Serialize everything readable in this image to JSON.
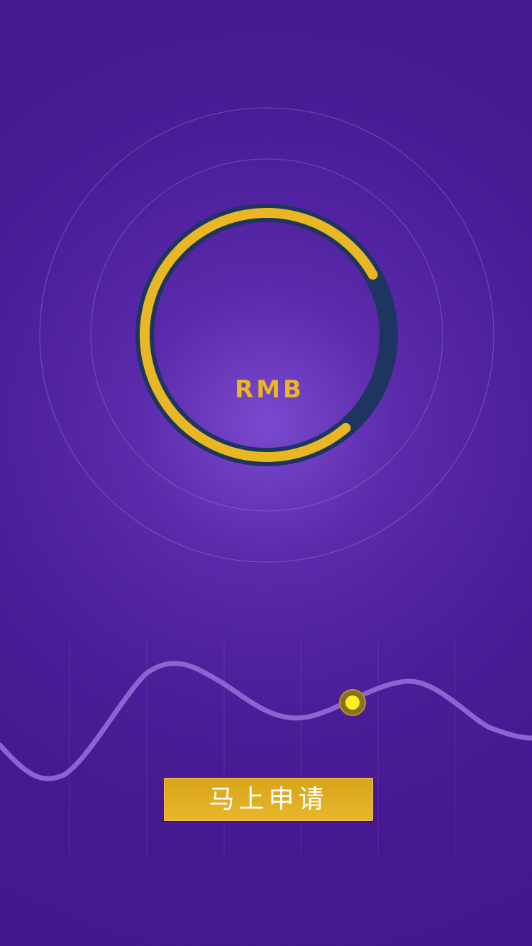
{
  "progress_ring": {
    "currency_label": "RMB",
    "fill_fraction": 0.78
  },
  "cta": {
    "label": "马上申请"
  },
  "colors": {
    "accent_gold": "#e8b723",
    "track_navy": "#1f3561",
    "wave": "#8d63d2",
    "marker": "#fff21a"
  }
}
